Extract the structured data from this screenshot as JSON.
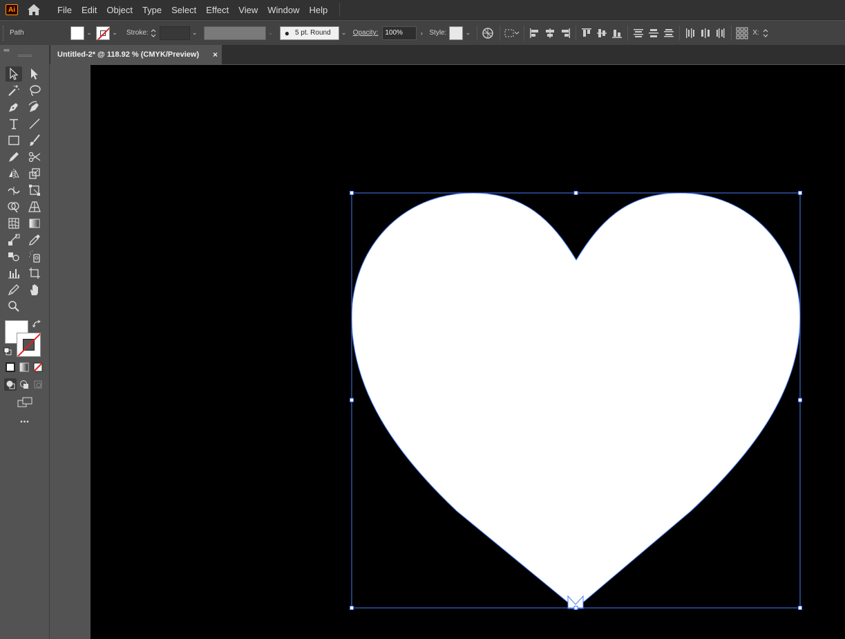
{
  "app": {
    "logo_text": "Ai",
    "accent": "#ff9a00"
  },
  "menu": [
    "File",
    "Edit",
    "Object",
    "Type",
    "Select",
    "Effect",
    "View",
    "Window",
    "Help"
  ],
  "control_bar": {
    "selection_type": "Path",
    "stroke_label": "Stroke:",
    "brush_label": "5 pt. Round",
    "opacity_label": "Opacity:",
    "opacity_value": "100%",
    "style_label": "Style:",
    "x_label": "X:"
  },
  "document": {
    "tab_title": "Untitled-2* @ 118.92 % (CMYK/Preview)",
    "close_glyph": "×"
  },
  "toolbar": {
    "collapse_glyph": "««",
    "more_glyph": "•••"
  },
  "canvas": {
    "background": "#000000",
    "shape": {
      "name": "heart",
      "fill": "#ffffff",
      "selection_color": "#4a7cf7"
    }
  }
}
